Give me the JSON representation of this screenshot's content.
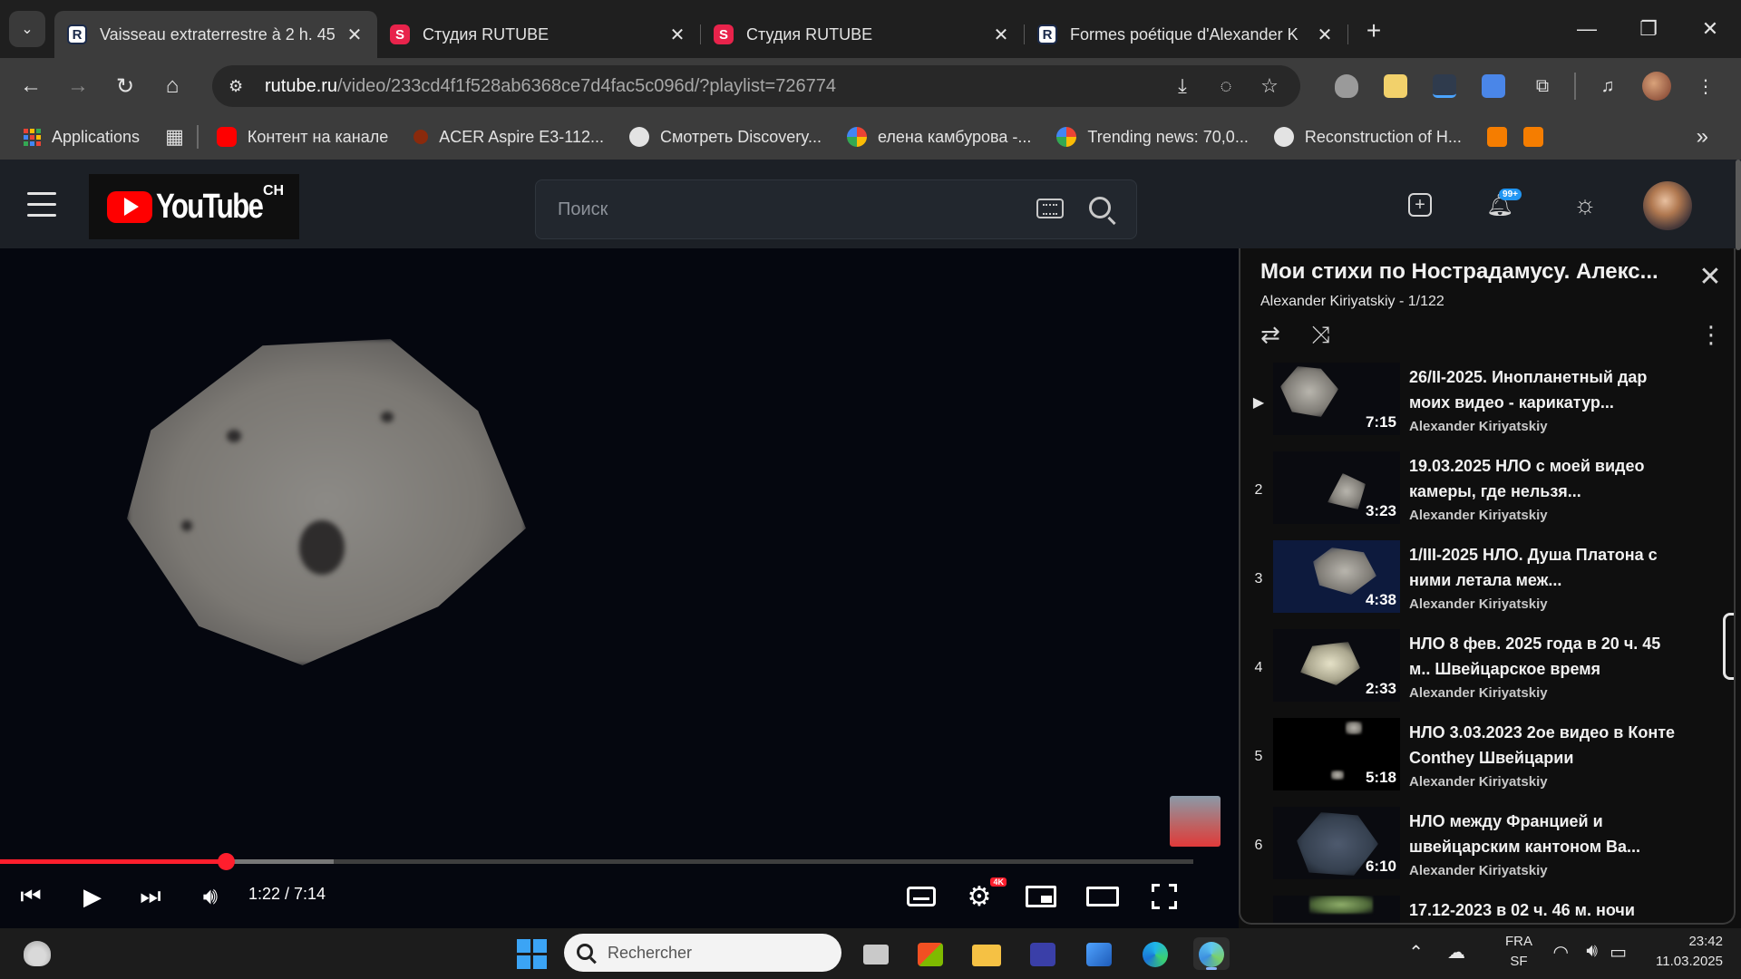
{
  "browser": {
    "tabs": [
      {
        "title": "Vaisseau extraterrestre à 2 h. 45",
        "favicon": "R",
        "active": true
      },
      {
        "title": "Студия RUTUBE",
        "favicon": "S",
        "active": false
      },
      {
        "title": "Студия RUTUBE",
        "favicon": "S",
        "active": false
      },
      {
        "title": "Formes poétique d'Alexander K",
        "favicon": "R",
        "active": false
      }
    ],
    "url_host": "rutube.ru",
    "url_path": "/video/233cd4f1f528ab6368ce7d4fac5c096d/?playlist=726774",
    "bookmarks": [
      {
        "label": "Applications",
        "icon": "apps-grid-icon"
      },
      {
        "label": "Контент на канале",
        "icon": "youtube-icon",
        "color": "#ff0000"
      },
      {
        "label": "ACER Aspire E3-112...",
        "icon": "acer-icon",
        "color": "#c2410c"
      },
      {
        "label": "Смотреть Discovery...",
        "icon": "globe-icon",
        "color": "#e3e3e3"
      },
      {
        "label": "елена камбурова -...",
        "icon": "google-icon",
        "color": "#ffffff"
      },
      {
        "label": "Trending news: 70,0...",
        "icon": "google-icon",
        "color": "#ffffff"
      },
      {
        "label": "Reconstruction of H...",
        "icon": "globe-icon",
        "color": "#e3e3e3"
      }
    ]
  },
  "site": {
    "logo_text": "YouTube",
    "logo_sup": "CH",
    "search_placeholder": "Поиск",
    "bell_badge": "99+"
  },
  "player": {
    "time": "1:22 / 7:14",
    "progress_fraction": 0.19,
    "buffer_fraction": 0.28,
    "settings_badge": "4K"
  },
  "playlist": {
    "title": "Мои стихи по Нострадамусу. Алекс...",
    "subtitle": "Alexander Kiriyatskiy - 1/122",
    "items": [
      {
        "index": "▶",
        "title": "26/II-2025. Инопланетный дар моих видео - карикатур...",
        "author": "Alexander Kiriyatskiy",
        "duration": "7:15"
      },
      {
        "index": "2",
        "title": "19.03.2025 НЛО с моей видео камеры, где нельзя...",
        "author": "Alexander Kiriyatskiy",
        "duration": "3:23"
      },
      {
        "index": "3",
        "title": "1/III-2025 НЛО. Душа Платона с ними летала меж...",
        "author": "Alexander Kiriyatskiy",
        "duration": "4:38"
      },
      {
        "index": "4",
        "title": "НЛО 8 фев. 2025 года в 20 ч. 45 м.. Швейцарское время",
        "author": "Alexander Kiriyatskiy",
        "duration": "2:33"
      },
      {
        "index": "5",
        "title": "НЛО 3.03.2023 2ое видео в Конте Conthey Швейцарии",
        "author": "Alexander Kiriyatskiy",
        "duration": "5:18"
      },
      {
        "index": "6",
        "title": "НЛО между Францией и швейцарским кантоном Ва...",
        "author": "Alexander Kiriyatskiy",
        "duration": "6:10"
      },
      {
        "index": "",
        "title": "17.12-2023 в 02 ч. 46 м. ночи",
        "author": "",
        "duration": ""
      }
    ]
  },
  "taskbar": {
    "search_placeholder": "Rechercher",
    "lang_top": "FRA",
    "lang_bottom": "SF",
    "time": "23:42",
    "date": "11.03.2025"
  },
  "colors": {
    "accent_red": "#ff1e2d",
    "header_bg": "#1c2026",
    "bell_badge": "#2196f3"
  }
}
